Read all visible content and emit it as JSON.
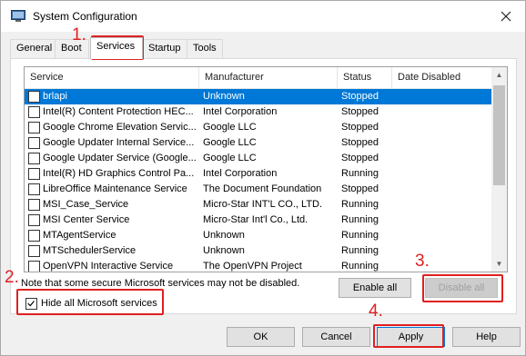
{
  "window": {
    "title": "System Configuration"
  },
  "tabs": [
    {
      "label": "General"
    },
    {
      "label": "Boot"
    },
    {
      "label": "Services"
    },
    {
      "label": "Startup"
    },
    {
      "label": "Tools"
    }
  ],
  "columns": [
    "Service",
    "Manufacturer",
    "Status",
    "Date Disabled"
  ],
  "services": [
    {
      "name": "brlapi",
      "manufacturer": "Unknown",
      "status": "Stopped"
    },
    {
      "name": "Intel(R) Content Protection HEC...",
      "manufacturer": "Intel Corporation",
      "status": "Stopped"
    },
    {
      "name": "Google Chrome Elevation Servic...",
      "manufacturer": "Google LLC",
      "status": "Stopped"
    },
    {
      "name": "Google Updater Internal Service...",
      "manufacturer": "Google LLC",
      "status": "Stopped"
    },
    {
      "name": "Google Updater Service (Google...",
      "manufacturer": "Google LLC",
      "status": "Stopped"
    },
    {
      "name": "Intel(R) HD Graphics Control Pa...",
      "manufacturer": "Intel Corporation",
      "status": "Running"
    },
    {
      "name": "LibreOffice Maintenance Service",
      "manufacturer": "The Document Foundation",
      "status": "Stopped"
    },
    {
      "name": "MSI_Case_Service",
      "manufacturer": "Micro-Star INT'L CO., LTD.",
      "status": "Running"
    },
    {
      "name": "MSI Center Service",
      "manufacturer": "Micro-Star Int'l Co., Ltd.",
      "status": "Running"
    },
    {
      "name": "MTAgentService",
      "manufacturer": "Unknown",
      "status": "Running"
    },
    {
      "name": "MTSchedulerService",
      "manufacturer": "Unknown",
      "status": "Running"
    },
    {
      "name": "OpenVPN Interactive Service",
      "manufacturer": "The OpenVPN Project",
      "status": "Running"
    }
  ],
  "note": "Note that some secure Microsoft services may not be disabled.",
  "buttons": {
    "enable_all": "Enable all",
    "disable_all": "Disable all",
    "ok": "OK",
    "cancel": "Cancel",
    "apply": "Apply",
    "help": "Help"
  },
  "hide_ms_label": "Hide all Microsoft services",
  "annotations": {
    "step1": "1.",
    "step2": "2.",
    "step3": "3.",
    "step4": "4."
  },
  "colors": {
    "highlight": "#e02020",
    "selection": "#0078d7"
  },
  "icons": [
    "system-configuration-icon",
    "close-icon",
    "checkbox-icon",
    "scroll-up-icon",
    "scroll-down-icon"
  ]
}
